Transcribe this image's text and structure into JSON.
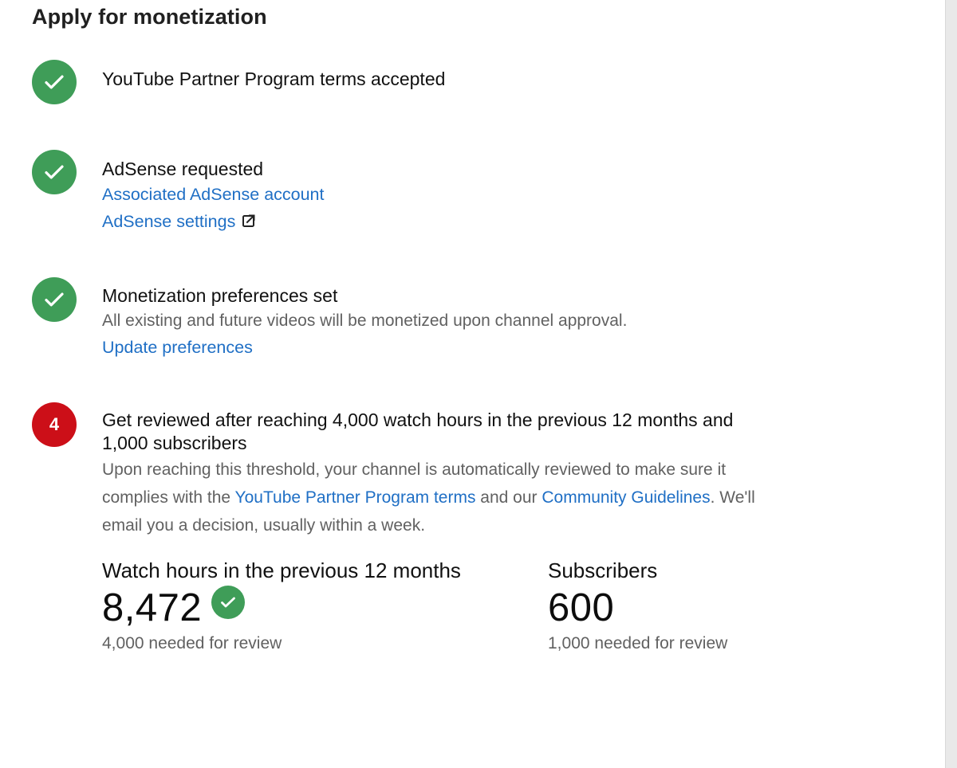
{
  "page": {
    "title": "Apply for monetization"
  },
  "steps": [
    {
      "status": "done",
      "icon": "checkmark-icon",
      "title": "YouTube Partner Program terms accepted"
    },
    {
      "status": "done",
      "icon": "checkmark-icon",
      "title": "AdSense requested",
      "links": [
        "Associated AdSense account",
        "AdSense settings"
      ]
    },
    {
      "status": "done",
      "icon": "checkmark-icon",
      "title": "Monetization preferences set",
      "description": "All existing and future videos will be monetized upon channel approval.",
      "links": [
        "Update preferences"
      ]
    },
    {
      "status": "pending",
      "number": "4",
      "title": "Get reviewed after reaching 4,000 watch hours in the previous 12 months and 1,000 subscribers",
      "description_part1": "Upon reaching this threshold, your channel is automatically reviewed to make sure it complies with the ",
      "link1": "YouTube Partner Program terms",
      "description_part2": " and our ",
      "link2": "Community Guidelines",
      "description_part3": ". We'll email you a decision, usually within a week."
    }
  ],
  "metrics": {
    "watch_hours": {
      "label": "Watch hours in the previous 12 months",
      "value": "8,472",
      "note": "4,000 needed for review",
      "met": true
    },
    "subscribers": {
      "label": "Subscribers",
      "value": "600",
      "note": "1,000 needed for review",
      "met": false
    }
  },
  "colors": {
    "success": "#3f9d58",
    "pending": "#cc0f18",
    "link": "#1f6fc5",
    "secondary_text": "#616161"
  }
}
